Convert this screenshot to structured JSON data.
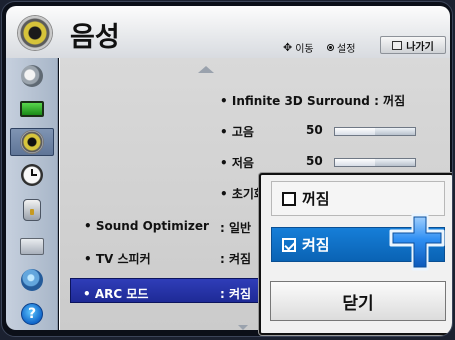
{
  "header": {
    "title": "음성",
    "hint_move": "이동",
    "hint_set": "설정",
    "exit_label": "나가기"
  },
  "sidebar": {
    "items": [
      {
        "icon": "satellite-dish-icon"
      },
      {
        "icon": "monitor-icon"
      },
      {
        "icon": "speaker-icon",
        "active": true
      },
      {
        "icon": "clock-icon"
      },
      {
        "icon": "lock-icon"
      },
      {
        "icon": "briefcase-icon"
      },
      {
        "icon": "globe-icon"
      },
      {
        "icon": "help-icon",
        "text": "?"
      }
    ]
  },
  "settings": {
    "surround": {
      "label": "• Infinite 3D Surround : 꺼짐"
    },
    "treble": {
      "label": "• 고음",
      "value": "50",
      "level": 50
    },
    "bass": {
      "label": "• 저음",
      "value": "50",
      "level": 50
    },
    "reset": {
      "label": "• 초기화"
    },
    "sound_optimizer": {
      "label": "• Sound Optimizer",
      "value": ": 일반"
    },
    "tv_speaker": {
      "label": "• TV 스피커",
      "value": ": 켜짐"
    },
    "arc_mode": {
      "label": "• ARC 모드",
      "value": ": 켜짐"
    }
  },
  "popup": {
    "off_label": "꺼짐",
    "on_label": "켜짐",
    "close_label": "닫기",
    "selected": "켜짐"
  },
  "colors": {
    "selection_blue": "#1e2a96",
    "popup_selected_blue": "#0a63b4",
    "cursor_blue": "#2f8ff3"
  }
}
